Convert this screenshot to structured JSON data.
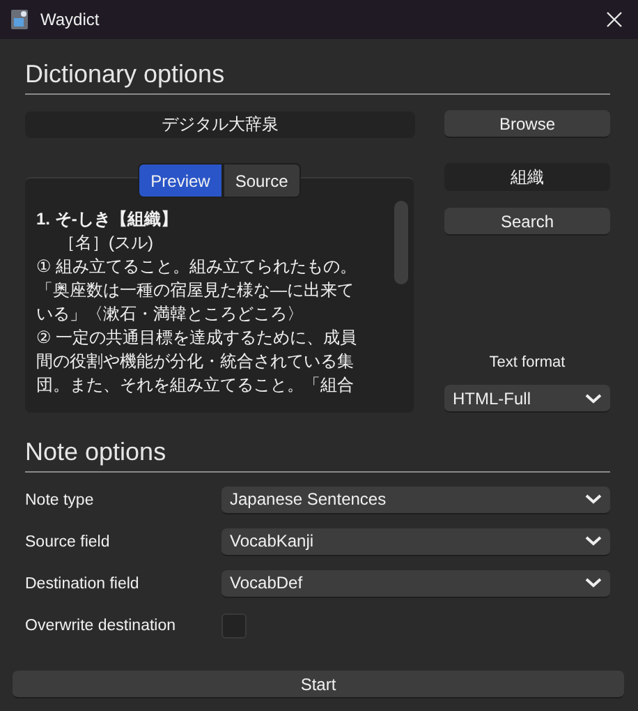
{
  "window": {
    "title": "Waydict"
  },
  "dictionary_options": {
    "heading": "Dictionary options",
    "dictionary_field": {
      "value": "デジタル大辞泉"
    },
    "browse_button": "Browse",
    "view_tabs": [
      {
        "label": "Preview",
        "selected": true
      },
      {
        "label": "Source",
        "selected": false
      }
    ],
    "preview_lines": [
      {
        "text": "1. そ-しき【組織】",
        "bold": true,
        "indent": false
      },
      {
        "text": "［名］(スル)",
        "bold": false,
        "indent": true
      },
      {
        "text": "① 組み立てること。組み立てられたもの。",
        "bold": false,
        "indent": false
      },
      {
        "text": "「奥座数は一種の宿屋見た様な—に出来て",
        "bold": false,
        "indent": false
      },
      {
        "text": "いる」〈漱石・満韓ところどころ〉",
        "bold": false,
        "indent": false
      },
      {
        "text": "② 一定の共通目標を達成するために、成員",
        "bold": false,
        "indent": false
      },
      {
        "text": "間の役割や機能が分化・統合されている集",
        "bold": false,
        "indent": false
      },
      {
        "text": "団。また、それを組み立てること。「組合",
        "bold": false,
        "indent": false
      }
    ],
    "search_field": {
      "value": "組織"
    },
    "search_button": "Search",
    "text_format": {
      "label": "Text format",
      "value": "HTML-Full"
    }
  },
  "note_options": {
    "heading": "Note options",
    "rows": [
      {
        "kind": "dropdown",
        "label": "Note type",
        "value": "Japanese Sentences"
      },
      {
        "kind": "dropdown",
        "label": "Source field",
        "value": "VocabKanji"
      },
      {
        "kind": "dropdown",
        "label": "Destination field",
        "value": "VocabDef"
      },
      {
        "kind": "checkbox",
        "label": "Overwrite destination",
        "checked": false
      }
    ]
  },
  "start_button": "Start"
}
